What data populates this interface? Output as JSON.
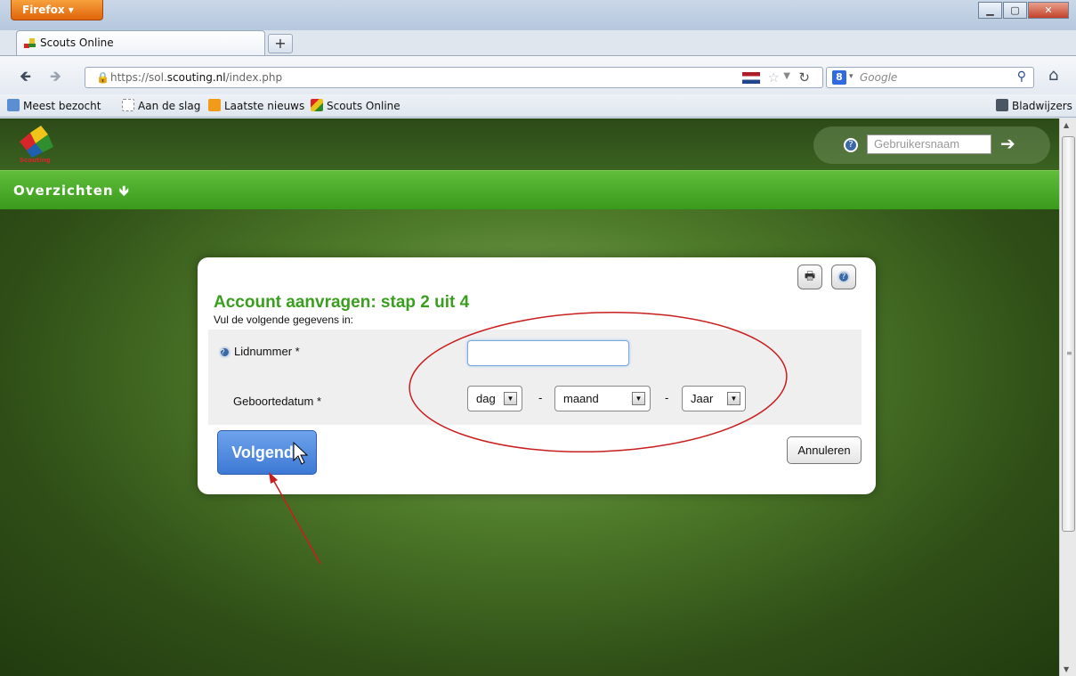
{
  "browser": {
    "menu_label": "Firefox ▾",
    "tab_title": "Scouts Online",
    "url_prefix": "https://sol.",
    "url_domain": "scouting.nl",
    "url_suffix": "/index.php",
    "search_placeholder": "Google",
    "bookmarks": [
      "Meest bezocht",
      "Aan de slag",
      "Laatste nieuws",
      "Scouts Online"
    ],
    "bookmarks_right": "Bladwijzers"
  },
  "site": {
    "logo_text": "Scouting",
    "username_placeholder": "Gebruikersnaam",
    "menu": "Overzichten"
  },
  "dialog": {
    "title": "Account aanvragen: stap 2 uit 4",
    "subtitle": "Vul de volgende gegevens in:",
    "lidnummer_label": "Lidnummer *",
    "lidnummer_value": "",
    "geboortedatum_label": "Geboortedatum *",
    "day_select": "dag",
    "month_select": "maand",
    "year_select": "Jaar",
    "separator": "-",
    "next_button": "Volgende",
    "cancel_button": "Annuleren"
  },
  "colors": {
    "title_green": "#3a9e1e",
    "menu_green": "#4aa827",
    "primary_blue": "#4a84dc",
    "annotation_red": "#c81e1e"
  }
}
